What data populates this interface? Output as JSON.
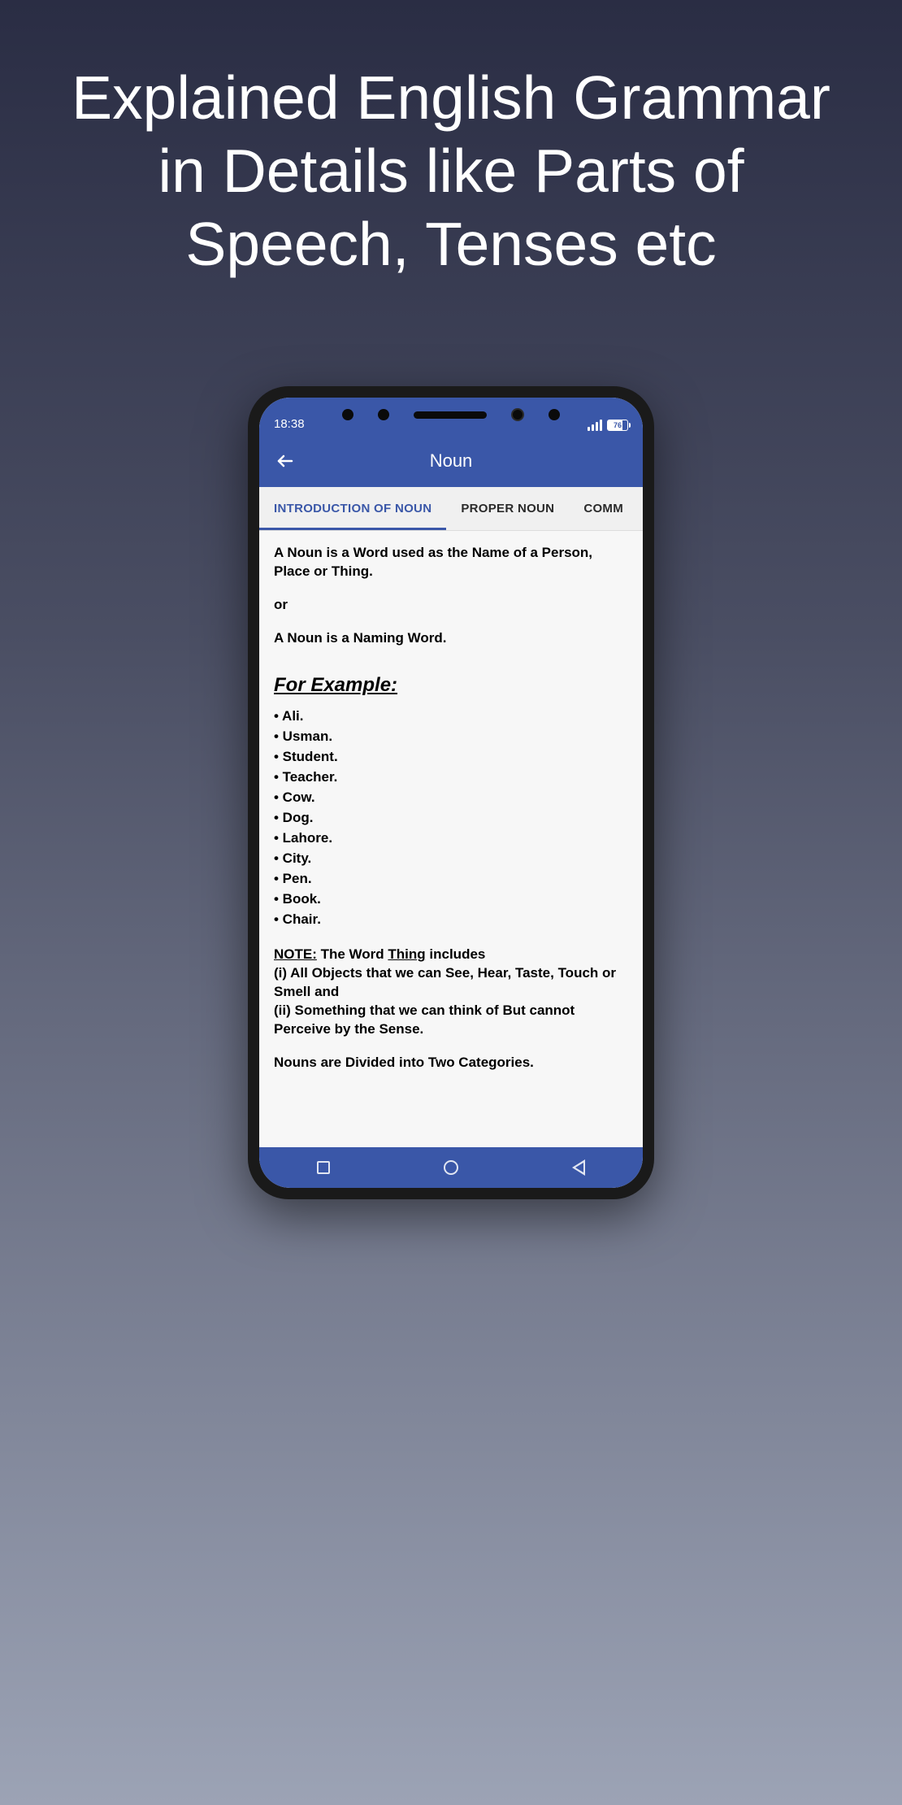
{
  "promo": {
    "title": "Explained English Grammar in Details like Parts of Speech, Tenses etc"
  },
  "status": {
    "time": "18:38",
    "battery": "76"
  },
  "appbar": {
    "title": "Noun"
  },
  "tabs": {
    "t0": "INTRODUCTION OF NOUN",
    "t1": "PROPER NOUN",
    "t2": "COMM"
  },
  "content": {
    "definition1": "A Noun is a Word used as the Name of a Person, Place or Thing.",
    "or": "or",
    "definition2": "A Noun is a Naming Word.",
    "exampleHeading": "For Example:",
    "examples": {
      "e0": "• Ali.",
      "e1": "• Usman.",
      "e2": "• Student.",
      "e3": "• Teacher.",
      "e4": "• Cow.",
      "e5": "• Dog.",
      "e6": "• Lahore.",
      "e7": "• City.",
      "e8": "• Pen.",
      "e9": "• Book.",
      "e10": "• Chair."
    },
    "noteLabel": "NOTE:",
    "noteText1": " The Word ",
    "noteThing": "Thing",
    "noteText2": " includes",
    "noteLine2": "(i) All Objects that we can See, Hear, Taste, Touch or Smell and",
    "noteLine3": "(ii) Something that we can think of But cannot Perceive by the Sense.",
    "divided": "Nouns are Divided into Two Categories."
  }
}
